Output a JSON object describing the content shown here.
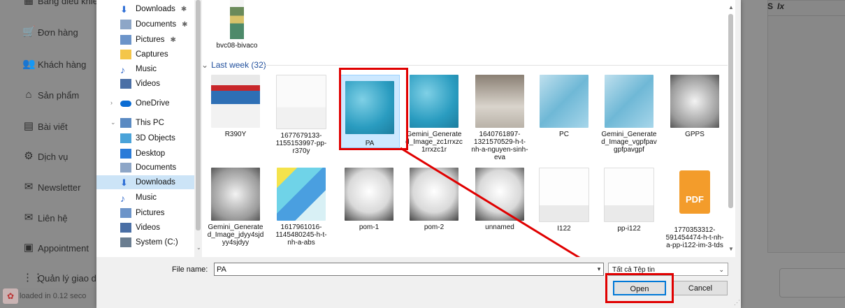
{
  "background_app": {
    "sidebar_items": [
      {
        "label": "Bảng điều khiể",
        "icon": "dashboard-icon"
      },
      {
        "label": "Đơn hàng",
        "icon": "cart-icon"
      },
      {
        "label": "Khách hàng",
        "icon": "users-icon"
      },
      {
        "label": "Sản phẩm",
        "icon": "shapes-icon"
      },
      {
        "label": "Bài viết",
        "icon": "document-icon"
      },
      {
        "label": "Dịch vụ",
        "icon": "cogs-icon"
      },
      {
        "label": "Newsletter",
        "icon": "mail-icon"
      },
      {
        "label": "Liên hệ",
        "icon": "mail-icon"
      },
      {
        "label": "Appointment",
        "icon": "calendar-icon"
      },
      {
        "label": "Quản lý giao diệ",
        "icon": "grid-icon"
      }
    ],
    "footer_text": "loaded in 0.12 seco",
    "editor_toolbar_glyphs": [
      "S",
      "Ix"
    ]
  },
  "dialog": {
    "nav": [
      {
        "label": "Downloads",
        "icon": "download-arrow-icon",
        "pinned": true
      },
      {
        "label": "Documents",
        "icon": "documents-icon",
        "pinned": true
      },
      {
        "label": "Pictures",
        "icon": "pictures-icon",
        "pinned": true
      },
      {
        "label": "Captures",
        "icon": "folder-icon",
        "pinned": false
      },
      {
        "label": "Music",
        "icon": "music-icon",
        "pinned": false
      },
      {
        "label": "Videos",
        "icon": "videos-icon",
        "pinned": false
      },
      {
        "label": "OneDrive",
        "icon": "onedrive-icon",
        "pinned": false
      },
      {
        "label": "This PC",
        "icon": "this-pc-icon",
        "pinned": false
      },
      {
        "label": "3D Objects",
        "icon": "3d-objects-icon",
        "pinned": false
      },
      {
        "label": "Desktop",
        "icon": "desktop-icon",
        "pinned": false
      },
      {
        "label": "Documents",
        "icon": "documents-icon",
        "pinned": false
      },
      {
        "label": "Downloads",
        "icon": "download-arrow-icon",
        "pinned": false
      },
      {
        "label": "Music",
        "icon": "music-icon",
        "pinned": false
      },
      {
        "label": "Pictures",
        "icon": "pictures-icon",
        "pinned": false
      },
      {
        "label": "Videos",
        "icon": "videos-icon",
        "pinned": false
      },
      {
        "label": "System (C:)",
        "icon": "drive-icon",
        "pinned": false
      }
    ],
    "top_file": {
      "label": "bvc08-bivaco"
    },
    "group_header": "Last week (32)",
    "files_row1": [
      {
        "label": "R390Y",
        "thumb": "bag"
      },
      {
        "label": "1677679133-1155153997-pp-r370y",
        "thumb": "pdfdoc"
      },
      {
        "label": "PA",
        "thumb": "blue"
      },
      {
        "label": "Gemini_Generated_Image_zc1rrxzc1rrxzc1r",
        "thumb": "blue"
      },
      {
        "label": "1640761897-1321570529-h-t-nh-a-nguyen-sinh-eva",
        "thumb": "grey"
      },
      {
        "label": "PC",
        "thumb": "lightblue"
      },
      {
        "label": "Gemini_Generated_Image_vgpfpavgpfpavgpf",
        "thumb": "lightblue"
      },
      {
        "label": "GPPS",
        "thumb": "clear"
      }
    ],
    "files_row2": [
      {
        "label": "Gemini_Generated_Image_jdyy4sjdyy4sjdyy",
        "thumb": "clear"
      },
      {
        "label": "1617961016-1145480245-h-t-nh-a-abs",
        "thumb": "colorful"
      },
      {
        "label": "pom-1",
        "thumb": "white"
      },
      {
        "label": "pom-2",
        "thumb": "white"
      },
      {
        "label": "unnamed",
        "thumb": "white"
      },
      {
        "label": "I122",
        "thumb": "doc"
      },
      {
        "label": "pp-i122",
        "thumb": "doc"
      },
      {
        "label": "1770353312-591454474-h-t-nh-a-pp-i122-im-3-tds",
        "thumb": "pdf"
      }
    ],
    "file_name_label": "File name:",
    "file_name_value": "PA",
    "file_type_value": "Tất cả Tệp tin",
    "open_label": "Open",
    "cancel_label": "Cancel",
    "pdf_badge": "PDF"
  }
}
